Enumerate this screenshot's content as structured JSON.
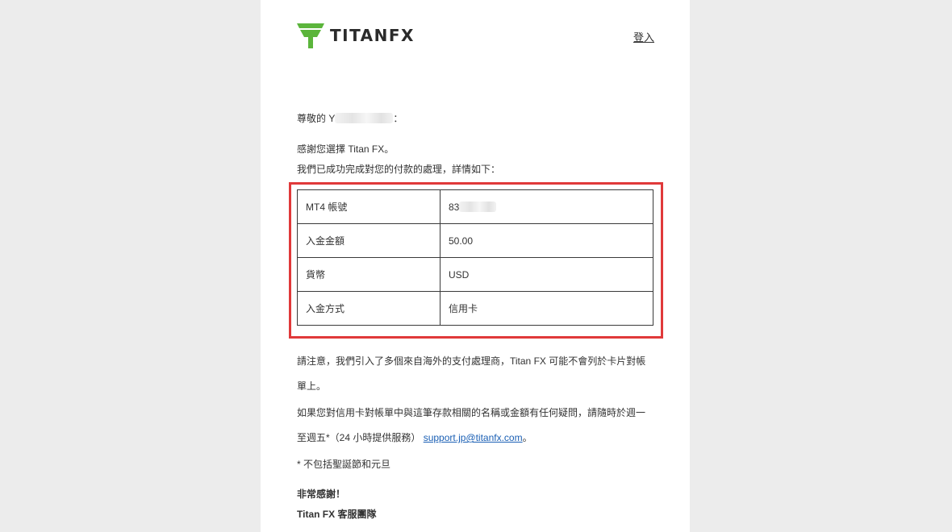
{
  "header": {
    "brand": "TITANFX",
    "login_label": "登入"
  },
  "email": {
    "greeting_prefix": "尊敬的 Y",
    "greeting_suffix": "：",
    "thanks_line": "感謝您選擇 Titan FX。",
    "done_line": "我們已成功完成對您的付款的處理，詳情如下：",
    "details": [
      {
        "label": "MT4 帳號",
        "value": "83"
      },
      {
        "label": "入金金額",
        "value": "50.00"
      },
      {
        "label": "貨幣",
        "value": "USD"
      },
      {
        "label": "入金方式",
        "value": "信用卡"
      }
    ],
    "notice": "請注意，我們引入了多個來自海外的支付處理商，Titan FX 可能不會列於卡片對帳單上。",
    "inquiry_text": "如果您對信用卡對帳單中與這筆存款相關的名稱或金額有任何疑問，請隨時於週一至週五*（24 小時提供服務）",
    "support_email": "support.jp@titanfx.com",
    "inquiry_end": "。",
    "footnote": "* 不包括聖誕節和元旦",
    "signoff": "非常感謝！",
    "team": "Titan FX 客服團隊"
  },
  "colors": {
    "logo_green": "#5bb53b",
    "highlight_red": "#e0393a",
    "link_blue": "#1a5fb4"
  }
}
